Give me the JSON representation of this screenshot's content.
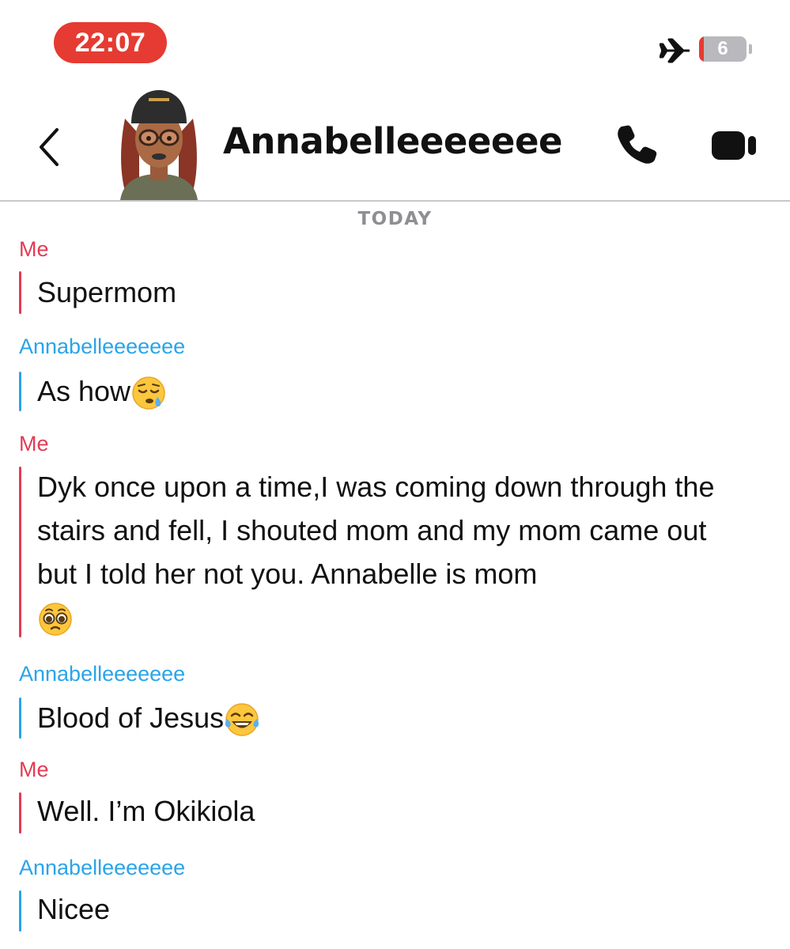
{
  "status_bar": {
    "time": "22:07",
    "battery_level": "6",
    "battery_fraction": 0.06,
    "icons": [
      "airplane-icon",
      "battery-icon"
    ],
    "colors": {
      "time_pill": "#e53b32",
      "battery_low": "#e53b32"
    }
  },
  "header": {
    "contact_name": "Annabelleeeeeee",
    "icons": [
      "back-chevron-icon",
      "bitmoji-avatar",
      "phone-icon",
      "video-camera-icon"
    ]
  },
  "chat": {
    "day_label": "TODAY",
    "colors": {
      "me": "#e23b53",
      "them": "#2ba4e8"
    },
    "messages": [
      {
        "sender": "Me",
        "text": "Supermom"
      },
      {
        "sender": "Annabelleeeeeee",
        "text": "As how",
        "emoji": "sleepy-face"
      },
      {
        "sender": "Me",
        "text": "Dyk once upon a time,I was coming down through the stairs and fell, I shouted mom and my mom came out but I told her not you. Annabelle is mom",
        "emoji": "pleading-face"
      },
      {
        "sender": "Annabelleeeeeee",
        "text": "Blood of Jesus",
        "emoji": "tears-of-joy"
      },
      {
        "sender": "Me",
        "text": "Well. I’m Okikiola"
      },
      {
        "sender": "Annabelleeeeeee",
        "text": "Nicee"
      }
    ]
  }
}
